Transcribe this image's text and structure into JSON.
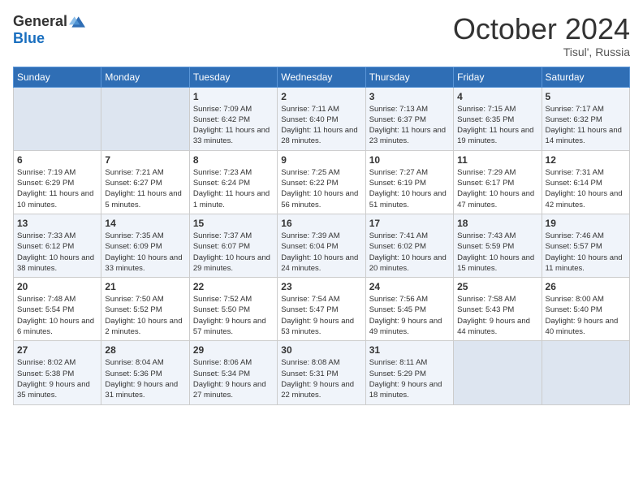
{
  "header": {
    "logo": {
      "general": "General",
      "blue": "Blue"
    },
    "month": "October 2024",
    "location": "Tisul', Russia"
  },
  "weekdays": [
    "Sunday",
    "Monday",
    "Tuesday",
    "Wednesday",
    "Thursday",
    "Friday",
    "Saturday"
  ],
  "weeks": [
    [
      null,
      null,
      {
        "day": 1,
        "sunrise": "7:09 AM",
        "sunset": "6:42 PM",
        "daylight": "11 hours and 33 minutes."
      },
      {
        "day": 2,
        "sunrise": "7:11 AM",
        "sunset": "6:40 PM",
        "daylight": "11 hours and 28 minutes."
      },
      {
        "day": 3,
        "sunrise": "7:13 AM",
        "sunset": "6:37 PM",
        "daylight": "11 hours and 23 minutes."
      },
      {
        "day": 4,
        "sunrise": "7:15 AM",
        "sunset": "6:35 PM",
        "daylight": "11 hours and 19 minutes."
      },
      {
        "day": 5,
        "sunrise": "7:17 AM",
        "sunset": "6:32 PM",
        "daylight": "11 hours and 14 minutes."
      }
    ],
    [
      {
        "day": 6,
        "sunrise": "7:19 AM",
        "sunset": "6:29 PM",
        "daylight": "11 hours and 10 minutes."
      },
      {
        "day": 7,
        "sunrise": "7:21 AM",
        "sunset": "6:27 PM",
        "daylight": "11 hours and 5 minutes."
      },
      {
        "day": 8,
        "sunrise": "7:23 AM",
        "sunset": "6:24 PM",
        "daylight": "11 hours and 1 minute."
      },
      {
        "day": 9,
        "sunrise": "7:25 AM",
        "sunset": "6:22 PM",
        "daylight": "10 hours and 56 minutes."
      },
      {
        "day": 10,
        "sunrise": "7:27 AM",
        "sunset": "6:19 PM",
        "daylight": "10 hours and 51 minutes."
      },
      {
        "day": 11,
        "sunrise": "7:29 AM",
        "sunset": "6:17 PM",
        "daylight": "10 hours and 47 minutes."
      },
      {
        "day": 12,
        "sunrise": "7:31 AM",
        "sunset": "6:14 PM",
        "daylight": "10 hours and 42 minutes."
      }
    ],
    [
      {
        "day": 13,
        "sunrise": "7:33 AM",
        "sunset": "6:12 PM",
        "daylight": "10 hours and 38 minutes."
      },
      {
        "day": 14,
        "sunrise": "7:35 AM",
        "sunset": "6:09 PM",
        "daylight": "10 hours and 33 minutes."
      },
      {
        "day": 15,
        "sunrise": "7:37 AM",
        "sunset": "6:07 PM",
        "daylight": "10 hours and 29 minutes."
      },
      {
        "day": 16,
        "sunrise": "7:39 AM",
        "sunset": "6:04 PM",
        "daylight": "10 hours and 24 minutes."
      },
      {
        "day": 17,
        "sunrise": "7:41 AM",
        "sunset": "6:02 PM",
        "daylight": "10 hours and 20 minutes."
      },
      {
        "day": 18,
        "sunrise": "7:43 AM",
        "sunset": "5:59 PM",
        "daylight": "10 hours and 15 minutes."
      },
      {
        "day": 19,
        "sunrise": "7:46 AM",
        "sunset": "5:57 PM",
        "daylight": "10 hours and 11 minutes."
      }
    ],
    [
      {
        "day": 20,
        "sunrise": "7:48 AM",
        "sunset": "5:54 PM",
        "daylight": "10 hours and 6 minutes."
      },
      {
        "day": 21,
        "sunrise": "7:50 AM",
        "sunset": "5:52 PM",
        "daylight": "10 hours and 2 minutes."
      },
      {
        "day": 22,
        "sunrise": "7:52 AM",
        "sunset": "5:50 PM",
        "daylight": "9 hours and 57 minutes."
      },
      {
        "day": 23,
        "sunrise": "7:54 AM",
        "sunset": "5:47 PM",
        "daylight": "9 hours and 53 minutes."
      },
      {
        "day": 24,
        "sunrise": "7:56 AM",
        "sunset": "5:45 PM",
        "daylight": "9 hours and 49 minutes."
      },
      {
        "day": 25,
        "sunrise": "7:58 AM",
        "sunset": "5:43 PM",
        "daylight": "9 hours and 44 minutes."
      },
      {
        "day": 26,
        "sunrise": "8:00 AM",
        "sunset": "5:40 PM",
        "daylight": "9 hours and 40 minutes."
      }
    ],
    [
      {
        "day": 27,
        "sunrise": "8:02 AM",
        "sunset": "5:38 PM",
        "daylight": "9 hours and 35 minutes."
      },
      {
        "day": 28,
        "sunrise": "8:04 AM",
        "sunset": "5:36 PM",
        "daylight": "9 hours and 31 minutes."
      },
      {
        "day": 29,
        "sunrise": "8:06 AM",
        "sunset": "5:34 PM",
        "daylight": "9 hours and 27 minutes."
      },
      {
        "day": 30,
        "sunrise": "8:08 AM",
        "sunset": "5:31 PM",
        "daylight": "9 hours and 22 minutes."
      },
      {
        "day": 31,
        "sunrise": "8:11 AM",
        "sunset": "5:29 PM",
        "daylight": "9 hours and 18 minutes."
      },
      null,
      null
    ]
  ],
  "labels": {
    "sunrise": "Sunrise:",
    "sunset": "Sunset:",
    "daylight": "Daylight:"
  }
}
